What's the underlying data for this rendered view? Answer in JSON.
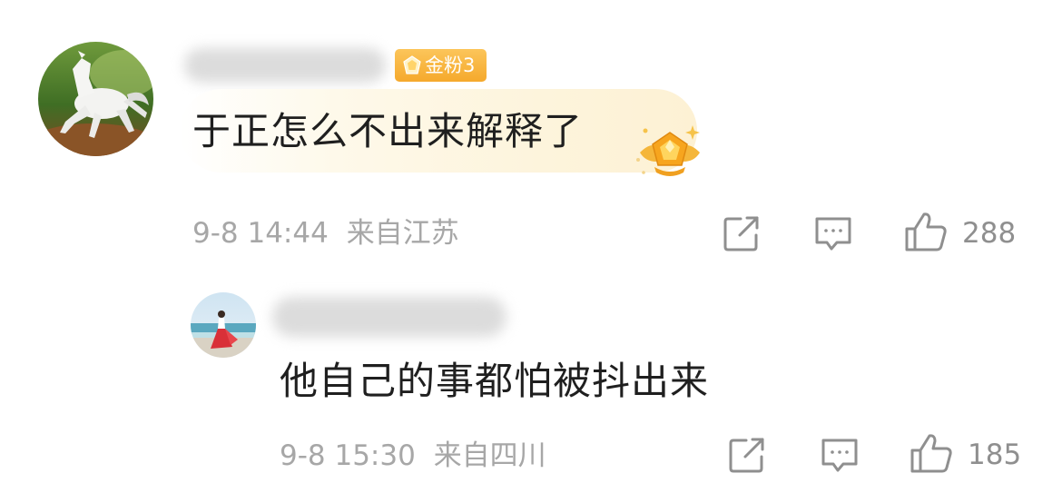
{
  "colors": {
    "text": "#1f1f1f",
    "meta": "#a7a7a7",
    "icon": "#8f8f8f",
    "fan_badge": "#f5a92c",
    "bubble": "#fdf4dc"
  },
  "comment": {
    "avatar_icon": "white-horse-avatar",
    "badge": {
      "icon": "gem-icon",
      "label": "金粉3"
    },
    "text": "于正怎么不出来解释了",
    "time": "9-8 14:44",
    "location": "来自江苏",
    "decoration_icon": "crown-gem-decoration",
    "actions": {
      "share_icon": "share-icon",
      "comment_icon": "comment-icon",
      "like_icon": "thumbs-up-icon",
      "like_count": "288"
    }
  },
  "reply": {
    "avatar_icon": "beach-girl-avatar",
    "text": "他自己的事都怕被抖出来",
    "time": "9-8 15:30",
    "location": "来自四川",
    "actions": {
      "share_icon": "share-icon",
      "comment_icon": "comment-icon",
      "like_icon": "thumbs-up-icon",
      "like_count": "185"
    }
  }
}
